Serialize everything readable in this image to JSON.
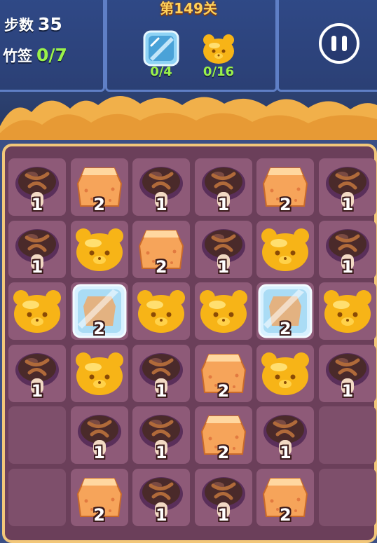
{
  "level_title": "第149关",
  "hud": {
    "steps_label": "步数",
    "steps_value": "35",
    "skewers_label": "竹签",
    "skewers_value": "0/7"
  },
  "goals": [
    {
      "icon": "ice-block-icon",
      "count": "0/4"
    },
    {
      "icon": "yellow-bear-jelly-icon",
      "count": "0/16"
    }
  ],
  "pause_icon": "pause-icon",
  "board": {
    "rows": 6,
    "cols": 6,
    "cells": [
      [
        {
          "t": "mushroom",
          "n": "1"
        },
        {
          "t": "cake",
          "n": "2"
        },
        {
          "t": "mushroom",
          "n": "1"
        },
        {
          "t": "mushroom",
          "n": "1"
        },
        {
          "t": "cake",
          "n": "2"
        },
        {
          "t": "mushroom",
          "n": "1"
        }
      ],
      [
        {
          "t": "mushroom",
          "n": "1"
        },
        {
          "t": "bear",
          "n": ""
        },
        {
          "t": "cake",
          "n": "2"
        },
        {
          "t": "mushroom",
          "n": "1"
        },
        {
          "t": "bear",
          "n": ""
        },
        {
          "t": "mushroom",
          "n": "1"
        }
      ],
      [
        {
          "t": "bear",
          "n": ""
        },
        {
          "t": "ice",
          "n": "2"
        },
        {
          "t": "bear",
          "n": ""
        },
        {
          "t": "bear",
          "n": ""
        },
        {
          "t": "ice",
          "n": "2"
        },
        {
          "t": "bear",
          "n": ""
        }
      ],
      [
        {
          "t": "mushroom",
          "n": "1"
        },
        {
          "t": "bear",
          "n": ""
        },
        {
          "t": "mushroom",
          "n": "1"
        },
        {
          "t": "cake",
          "n": "2"
        },
        {
          "t": "bear",
          "n": ""
        },
        {
          "t": "mushroom",
          "n": "1"
        }
      ],
      [
        {
          "t": "empty",
          "n": ""
        },
        {
          "t": "mushroom",
          "n": "1"
        },
        {
          "t": "mushroom",
          "n": "1"
        },
        {
          "t": "cake",
          "n": "2"
        },
        {
          "t": "mushroom",
          "n": "1"
        },
        {
          "t": "empty",
          "n": ""
        }
      ],
      [
        {
          "t": "empty",
          "n": ""
        },
        {
          "t": "cake",
          "n": "2"
        },
        {
          "t": "mushroom",
          "n": "1"
        },
        {
          "t": "mushroom",
          "n": "1"
        },
        {
          "t": "cake",
          "n": "2"
        },
        {
          "t": "empty",
          "n": ""
        }
      ]
    ]
  },
  "colors": {
    "bear": "#f7b417",
    "cake": "#f6a45a",
    "mushroom": "#4a2a2a",
    "ice": "#bfe8ff",
    "board_bg": "#6b3f5a",
    "cell_bg": "#8e5a78",
    "hud_green": "#9af24a",
    "title_gold": "#ffd15a"
  }
}
